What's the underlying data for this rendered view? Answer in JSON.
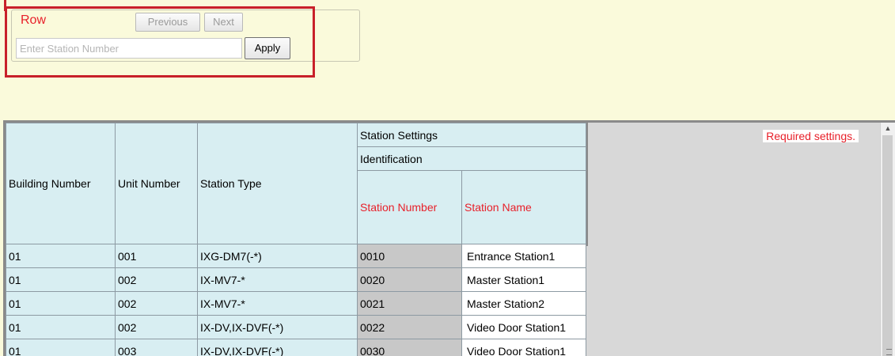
{
  "toolbar": {
    "row_label": "Row",
    "previous_label": "Previous",
    "next_label": "Next",
    "station_input_placeholder": "Enter Station Number",
    "station_input_value": "",
    "apply_label": "Apply"
  },
  "table": {
    "group_header": "Station Settings",
    "subgroup_header": "Identification",
    "columns": [
      "Building Number",
      "Unit Number",
      "Station Type",
      "Station Number",
      "Station Name"
    ],
    "required_columns": [
      "Station Number",
      "Station Name"
    ],
    "rows": [
      [
        "01",
        "001",
        "IXG-DM7(-*)",
        "0010",
        "Entrance Station1"
      ],
      [
        "01",
        "002",
        "IX-MV7-*",
        "0020",
        "Master Station1"
      ],
      [
        "01",
        "002",
        "IX-MV7-*",
        "0021",
        "Master Station2"
      ],
      [
        "01",
        "002",
        "IX-DV,IX-DVF(-*)",
        "0022",
        "Video Door Station1"
      ],
      [
        "01",
        "003",
        "IX-DV,IX-DVF(-*)",
        "0030",
        "Video Door Station1"
      ]
    ]
  },
  "notes": {
    "required": "Required settings."
  },
  "colors": {
    "accent_red": "#e8202a",
    "header_cyan": "#d8eef2",
    "page_background": "#fafadb"
  }
}
